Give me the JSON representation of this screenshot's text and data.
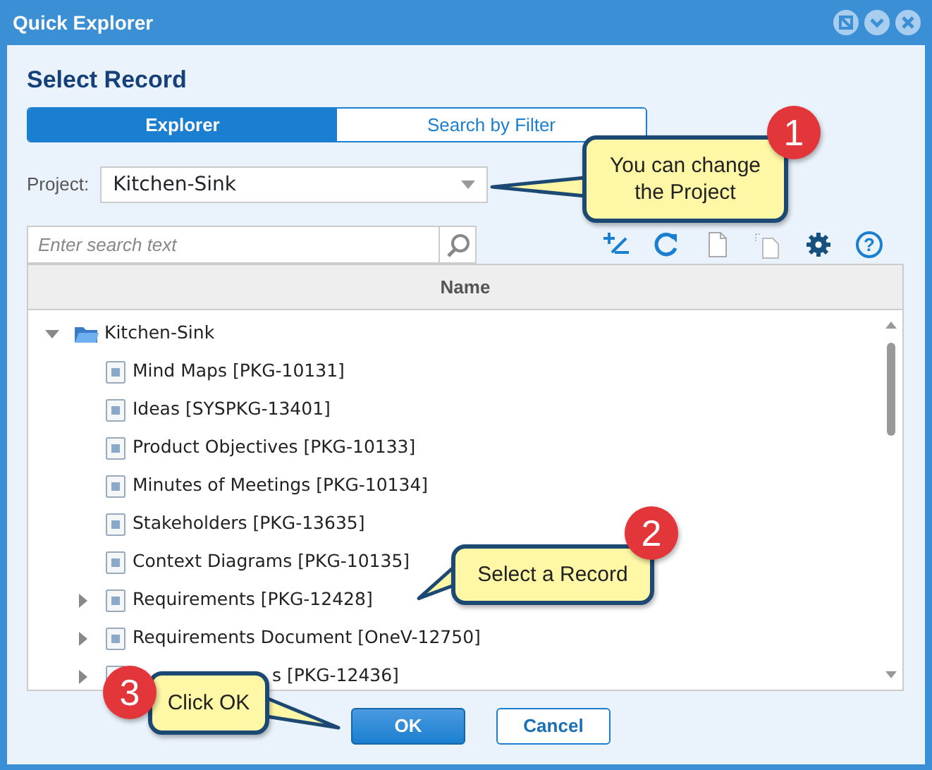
{
  "window": {
    "title": "Quick Explorer"
  },
  "heading": "Select Record",
  "tabs": [
    {
      "label": "Explorer",
      "selected": true
    },
    {
      "label": "Search by Filter",
      "selected": false
    }
  ],
  "project": {
    "label": "Project:",
    "value": "Kitchen-Sink"
  },
  "search": {
    "placeholder": "Enter search text"
  },
  "toolbar": [
    {
      "kind": "expand-collapse"
    },
    {
      "kind": "refresh"
    },
    {
      "kind": "new"
    },
    {
      "kind": "copy"
    },
    {
      "kind": "settings"
    },
    {
      "kind": "help",
      "glyph": "?"
    }
  ],
  "tree": {
    "column": "Name",
    "items": [
      {
        "label": "Kitchen-Sink",
        "kind": "branch",
        "expanded": true,
        "children": [
          {
            "label": "Mind Maps [PKG-10131]",
            "kind": "leaf"
          },
          {
            "label": "Ideas [SYSPKG-13401]",
            "kind": "leaf"
          },
          {
            "label": "Product Objectives [PKG-10133]",
            "kind": "leaf"
          },
          {
            "label": "Minutes of Meetings [PKG-10134]",
            "kind": "leaf"
          },
          {
            "label": "Stakeholders [PKG-13635]",
            "kind": "leaf"
          },
          {
            "label": "Context Diagrams [PKG-10135]",
            "kind": "leaf"
          },
          {
            "label": "Requirements [PKG-12428]",
            "kind": "branch",
            "expanded": false
          },
          {
            "label": "Requirements Document [OneV-12750]",
            "kind": "branch",
            "expanded": false
          },
          {
            "label": "s [PKG-12436]",
            "kind": "branch",
            "expanded": false
          }
        ]
      }
    ]
  },
  "buttons": [
    {
      "label": "OK",
      "kind": "primary"
    },
    {
      "label": "Cancel",
      "kind": "secondary"
    }
  ],
  "callouts": [
    {
      "number": "1",
      "lines": [
        "You can change",
        "the Project"
      ]
    },
    {
      "number": "2",
      "lines": [
        "Select a Record"
      ]
    },
    {
      "number": "3",
      "lines": [
        "Click OK"
      ]
    }
  ]
}
